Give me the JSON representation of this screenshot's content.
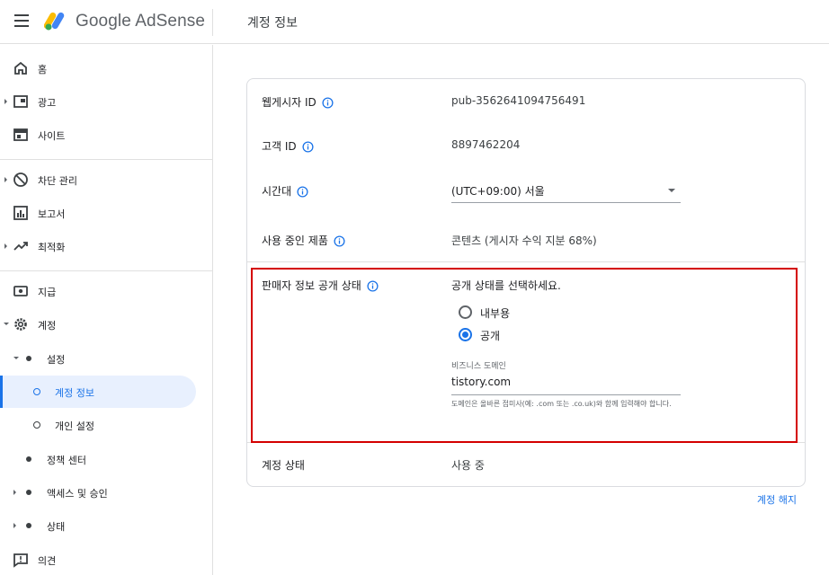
{
  "header": {
    "brand": "Google AdSense",
    "page_title": "계정 정보"
  },
  "sidebar": {
    "items": [
      {
        "label": "홈",
        "icon": "home-icon"
      },
      {
        "label": "광고",
        "icon": "ads-icon"
      },
      {
        "label": "사이트",
        "icon": "sites-icon"
      },
      {
        "label": "차단 관리",
        "icon": "block-icon"
      },
      {
        "label": "보고서",
        "icon": "reports-icon"
      },
      {
        "label": "최적화",
        "icon": "trending-icon"
      },
      {
        "label": "지급",
        "icon": "payments-icon"
      },
      {
        "label": "계정",
        "icon": "gear-icon"
      },
      {
        "label": "설정"
      },
      {
        "label": "계정 정보"
      },
      {
        "label": "개인 설정"
      },
      {
        "label": "정책 센터"
      },
      {
        "label": "액세스 및 승인"
      },
      {
        "label": "상태"
      },
      {
        "label": "의견",
        "icon": "feedback-icon"
      }
    ]
  },
  "account": {
    "publisher_id_label": "웹게시자 ID",
    "publisher_id": "pub-3562641094756491",
    "customer_id_label": "고객 ID",
    "customer_id": "8897462204",
    "timezone_label": "시간대",
    "timezone": "(UTC+09:00) 서울",
    "product_label": "사용 중인 제품",
    "product": "콘텐츠 (게시자 수익 지분 68%)",
    "seller_label": "판매자 정보 공개 상태",
    "seller_prompt": "공개 상태를 선택하세요.",
    "radio_internal": "내부용",
    "radio_public": "공개",
    "domain_label": "비즈니스 도메인",
    "domain_value": "tistory.com",
    "domain_hint": "도메인은 올바른 접미사(예: .com 또는 .co.uk)와 함께 입력해야 합니다.",
    "status_label": "계정 상태",
    "status": "사용 중"
  },
  "close_account": "계정 해지",
  "colors": {
    "accent": "#1a73e8",
    "highlight_border": "#d40000"
  }
}
